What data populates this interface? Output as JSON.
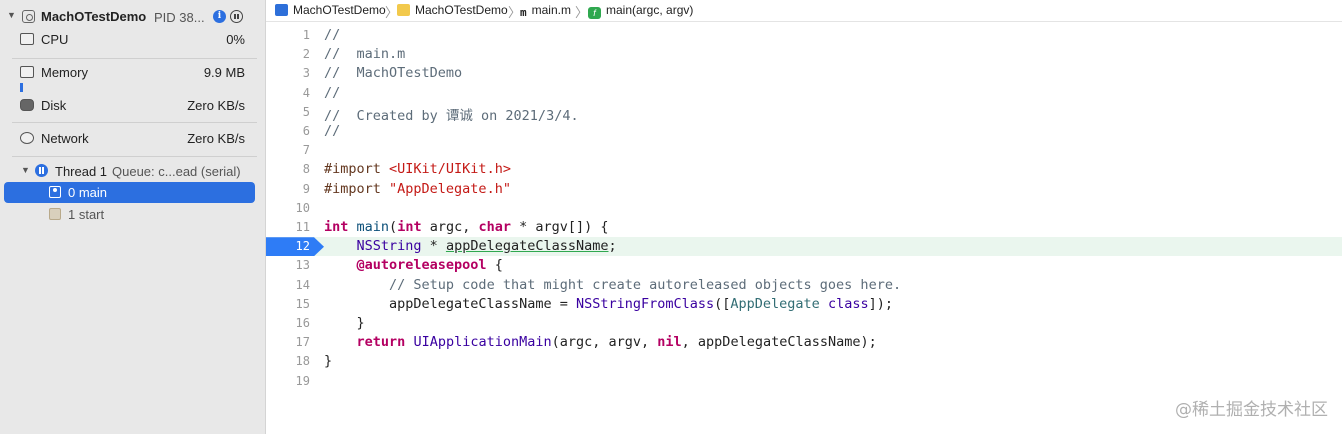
{
  "process": {
    "name": "MachOTestDemo",
    "pid": "PID 38..."
  },
  "gauges": [
    {
      "label": "CPU",
      "value": "0%"
    },
    {
      "label": "Memory",
      "value": "9.9 MB"
    },
    {
      "label": "Disk",
      "value": "Zero KB/s"
    },
    {
      "label": "Network",
      "value": "Zero KB/s"
    }
  ],
  "thread": {
    "label": "Thread 1",
    "queue": "Queue: c...ead (serial)"
  },
  "frames": [
    {
      "label": "0 main",
      "selected": true
    },
    {
      "label": "1 start",
      "selected": false
    }
  ],
  "breadcrumbs": [
    "MachOTestDemo",
    "MachOTestDemo",
    "main.m",
    "main(argc, argv)"
  ],
  "editor": {
    "current_line": 12,
    "lines": [
      {
        "n": "1",
        "html": "<span class=\"cm\">//</span>"
      },
      {
        "n": "2",
        "html": "<span class=\"cm\">//  main.m</span>"
      },
      {
        "n": "3",
        "html": "<span class=\"cm\">//  MachOTestDemo</span>"
      },
      {
        "n": "4",
        "html": "<span class=\"cm\">//</span>"
      },
      {
        "n": "5",
        "html": "<span class=\"cm\">//  Created by 谭诚 on 2021/3/4.</span>"
      },
      {
        "n": "6",
        "html": "<span class=\"cm\">//</span>"
      },
      {
        "n": "7",
        "html": ""
      },
      {
        "n": "8",
        "html": "<span class=\"pp\">#import </span><span class=\"str\">&lt;UIKit/UIKit.h&gt;</span>"
      },
      {
        "n": "9",
        "html": "<span class=\"pp\">#import </span><span class=\"str\">\"AppDelegate.h\"</span>"
      },
      {
        "n": "10",
        "html": ""
      },
      {
        "n": "11",
        "html": "<span class=\"kw\">int</span> <span class=\"typ\">main</span>(<span class=\"kw\">int</span> argc, <span class=\"kw\">char</span> * argv[]) {"
      },
      {
        "n": "12",
        "html": "    <span class=\"cls\">NSString</span> * <span class=\"ul\">appDelegateClassName</span>;"
      },
      {
        "n": "13",
        "html": "    <span class=\"kw\">@autoreleasepool</span> {"
      },
      {
        "n": "14",
        "html": "        <span class=\"cm\">// Setup code that might create autoreleased objects goes here.</span>"
      },
      {
        "n": "15",
        "html": "        appDelegateClassName = <span class=\"cls\">NSStringFromClass</span>([<span class=\"fn\">AppDelegate</span> <span class=\"cls\">class</span>]);"
      },
      {
        "n": "16",
        "html": "    }"
      },
      {
        "n": "17",
        "html": "    <span class=\"kw\">return</span> <span class=\"cls\">UIApplicationMain</span>(argc, argv, <span class=\"kw\">nil</span>, appDelegateClassName);"
      },
      {
        "n": "18",
        "html": "}"
      },
      {
        "n": "19",
        "html": ""
      }
    ]
  },
  "watermark": "@稀土掘金技术社区"
}
